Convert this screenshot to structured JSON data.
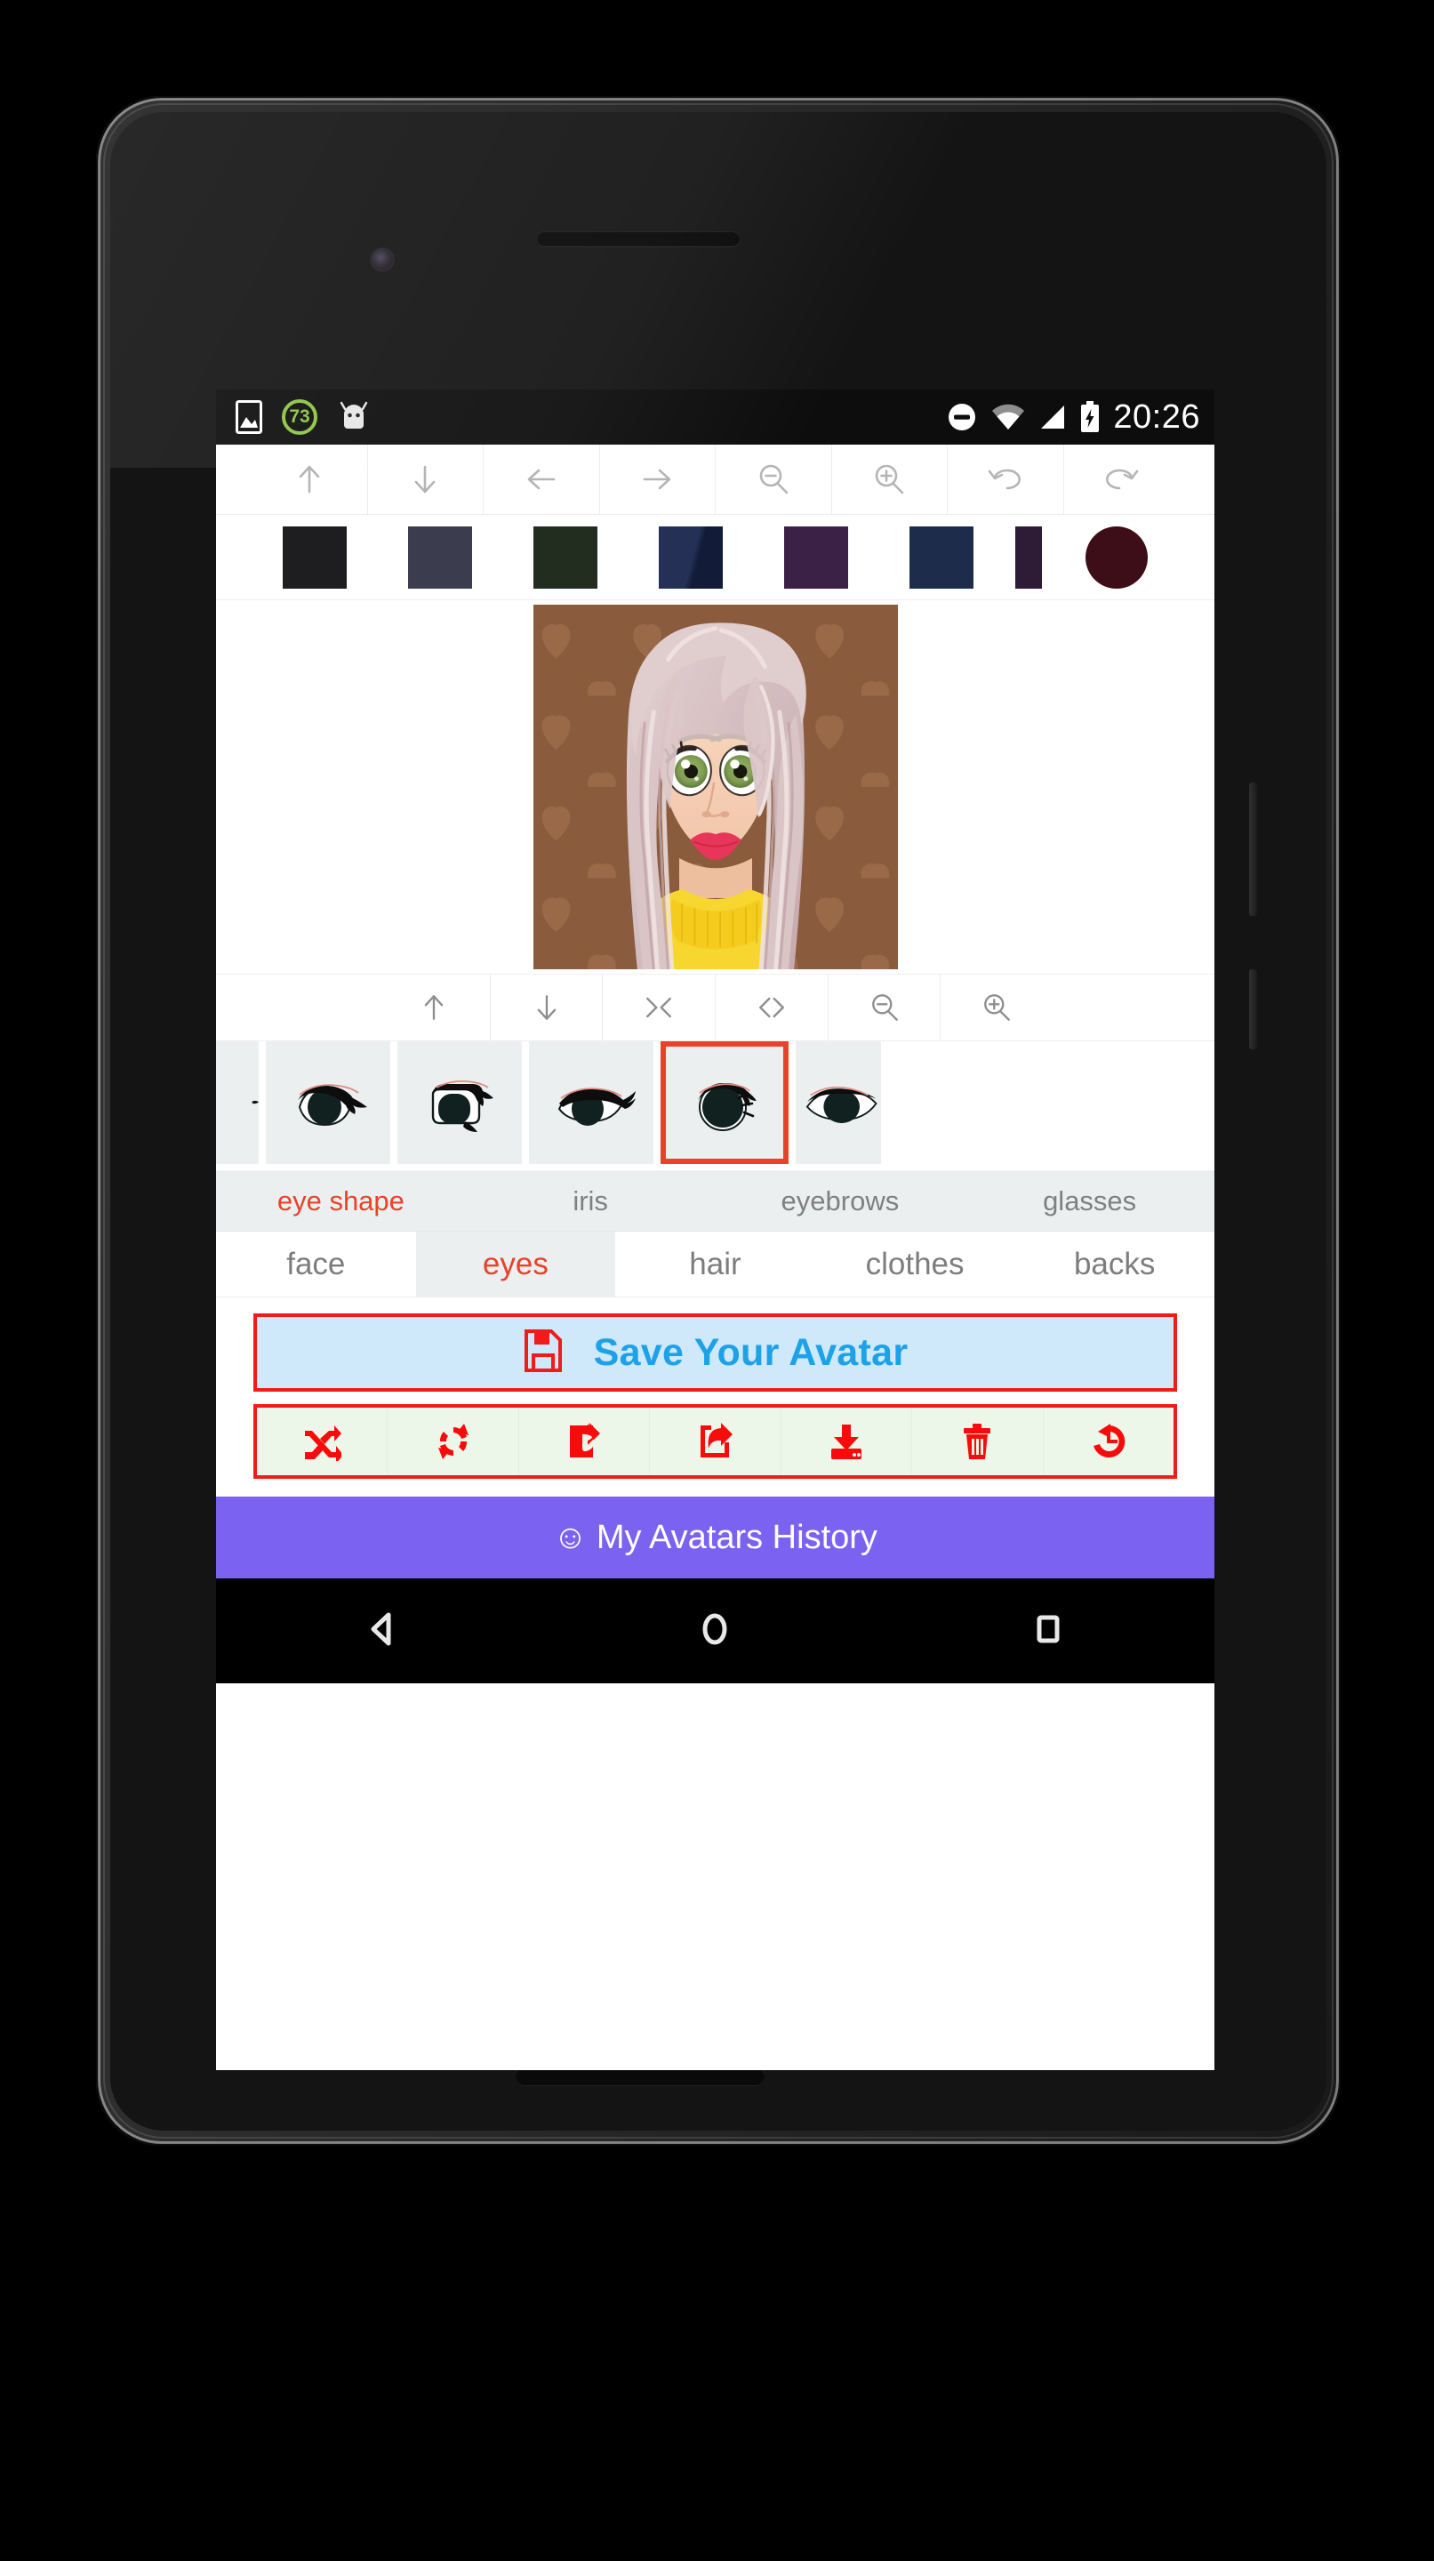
{
  "statusbar": {
    "time": "20:26",
    "icons": [
      {
        "name": "image-icon"
      },
      {
        "name": "battery-saver-badge",
        "value": "73"
      },
      {
        "name": "android-robot-icon"
      }
    ],
    "right_icons": [
      {
        "name": "do-not-disturb-icon"
      },
      {
        "name": "wifi-icon"
      },
      {
        "name": "cellular-signal-icon"
      },
      {
        "name": "battery-charging-icon"
      }
    ]
  },
  "toolbar_top": {
    "buttons": [
      {
        "name": "move-up-button",
        "icon": "arrow-up-icon"
      },
      {
        "name": "move-down-button",
        "icon": "arrow-down-icon"
      },
      {
        "name": "move-left-button",
        "icon": "arrow-left-icon"
      },
      {
        "name": "move-right-button",
        "icon": "arrow-right-icon"
      },
      {
        "name": "zoom-out-button",
        "icon": "magnifier-minus-icon"
      },
      {
        "name": "zoom-in-button",
        "icon": "magnifier-plus-icon"
      },
      {
        "name": "undo-button",
        "icon": "undo-arrow-icon"
      },
      {
        "name": "redo-button",
        "icon": "redo-arrow-icon"
      }
    ]
  },
  "color_palette": {
    "swatches": [
      {
        "name": "color-swatch-1",
        "hex": "#1e1e20",
        "shape": "rect"
      },
      {
        "name": "color-swatch-2",
        "hex": "#3b3d4e",
        "shape": "rect"
      },
      {
        "name": "color-swatch-3",
        "hex": "#222d20",
        "shape": "rect"
      },
      {
        "name": "color-swatch-4",
        "hex": "#1c2746",
        "shape": "rect"
      },
      {
        "name": "color-swatch-5",
        "hex": "#3b2146",
        "shape": "rect"
      },
      {
        "name": "color-swatch-6",
        "hex": "#1c2c4a",
        "shape": "rect"
      },
      {
        "name": "color-swatch-7",
        "hex": "#2e1b35",
        "shape": "clip"
      },
      {
        "name": "current-color-indicator",
        "hex": "#3d0d18",
        "shape": "circle"
      }
    ]
  },
  "avatar": {
    "background_color": "#8a5b3c",
    "background_pattern": "hearts",
    "hair_color": "#d9c3c6",
    "skin_color": "#f6cfb4",
    "eye_color": "#8aa85c",
    "lip_color": "#e8365a",
    "clothes_color": "#f7d630"
  },
  "toolbar_mid": {
    "buttons": [
      {
        "name": "item-up-button",
        "icon": "arrow-up-icon"
      },
      {
        "name": "item-down-button",
        "icon": "arrow-down-icon"
      },
      {
        "name": "narrow-button",
        "icon": "collapse-horizontal-icon"
      },
      {
        "name": "widen-button",
        "icon": "expand-horizontal-icon"
      },
      {
        "name": "item-zoom-out-button",
        "icon": "magnifier-minus-icon"
      },
      {
        "name": "item-zoom-in-button",
        "icon": "magnifier-plus-icon"
      }
    ]
  },
  "eye_carousel": {
    "items": [
      {
        "name": "eye-shape-option-0",
        "style": "partial",
        "selected": false
      },
      {
        "name": "eye-shape-option-1",
        "style": "almond-lash",
        "selected": false
      },
      {
        "name": "eye-shape-option-2",
        "style": "square-lash",
        "selected": false
      },
      {
        "name": "eye-shape-option-3",
        "style": "cat-lash",
        "selected": false
      },
      {
        "name": "eye-shape-option-4",
        "style": "round-big",
        "selected": true
      },
      {
        "name": "eye-shape-option-5",
        "style": "wide-oval",
        "selected": false
      }
    ],
    "selected_border_color": "#e8432a"
  },
  "subtabs": {
    "items": [
      {
        "name": "subtab-eye-shape",
        "label": "eye shape",
        "active": true
      },
      {
        "name": "subtab-iris",
        "label": "iris",
        "active": false
      },
      {
        "name": "subtab-eyebrows",
        "label": "eyebrows",
        "active": false
      },
      {
        "name": "subtab-glasses",
        "label": "glasses",
        "active": false
      }
    ]
  },
  "maintabs": {
    "items": [
      {
        "name": "tab-face",
        "label": "face",
        "active": false
      },
      {
        "name": "tab-eyes",
        "label": "eyes",
        "active": true
      },
      {
        "name": "tab-hair",
        "label": "hair",
        "active": false
      },
      {
        "name": "tab-clothes",
        "label": "clothes",
        "active": false
      },
      {
        "name": "tab-backs",
        "label": "backs",
        "active": false
      }
    ]
  },
  "save_button": {
    "label": "Save Your Avatar",
    "icon": "floppy-disk-save-icon",
    "text_color": "#1da2e8",
    "background_color": "#cfe8fa",
    "border_color": "#f21a1a"
  },
  "action_bar": {
    "background_color": "#edf7e9",
    "border_color": "#f21a1a",
    "icon_color": "#fa0a0a",
    "buttons": [
      {
        "name": "randomize-button",
        "icon": "shuffle-icon"
      },
      {
        "name": "refresh-button",
        "icon": "refresh-sync-icon"
      },
      {
        "name": "share-button",
        "icon": "share-filled-icon"
      },
      {
        "name": "send-to-button",
        "icon": "share-outline-icon"
      },
      {
        "name": "download-button",
        "icon": "download-icon"
      },
      {
        "name": "delete-button",
        "icon": "trash-icon"
      },
      {
        "name": "restore-button",
        "icon": "history-restore-icon"
      }
    ]
  },
  "banner": {
    "label": "My Avatars History",
    "emoji": "☺",
    "background_color": "#7c62f0"
  },
  "navbar": {
    "buttons": [
      {
        "name": "nav-back-button",
        "icon": "back-triangle-icon"
      },
      {
        "name": "nav-home-button",
        "icon": "home-circle-icon"
      },
      {
        "name": "nav-recents-button",
        "icon": "recents-square-icon"
      }
    ]
  }
}
